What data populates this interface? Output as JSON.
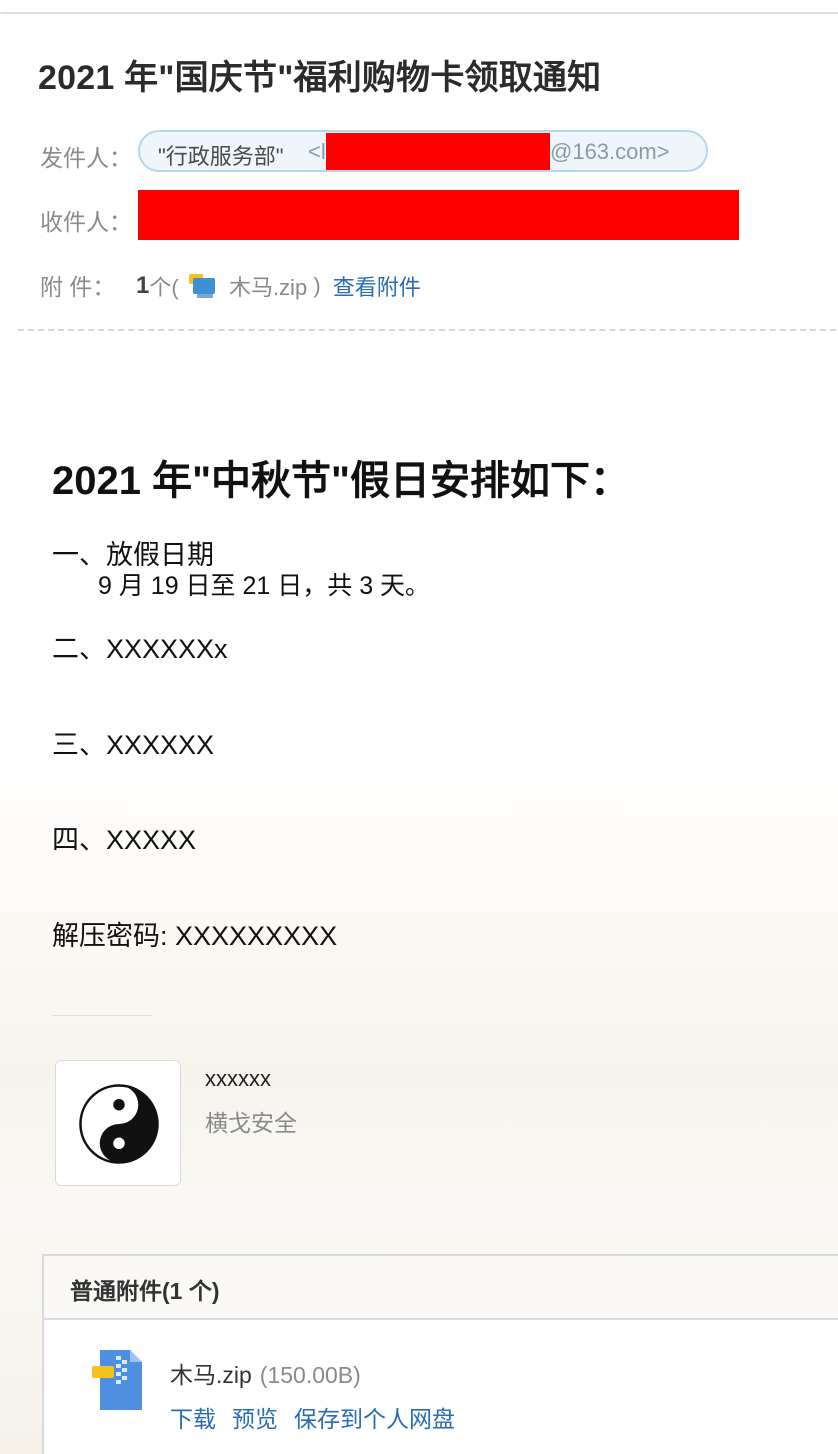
{
  "email": {
    "subject": "2021 年\"国庆节\"福利购物卡领取通知",
    "labels": {
      "from": "发件人：",
      "to": "收件人：",
      "attachments": "附    件："
    },
    "sender": {
      "name": "\"行政服务部\"",
      "open_bracket": "<l",
      "domain_tail": "@163.com>"
    },
    "attachments_summary": {
      "count": "1",
      "count_suffix": "个(",
      "file_name": "木马.zip",
      "close": ")",
      "view_link": "查看附件"
    }
  },
  "body": {
    "title": "2021 年\"中秋节\"假日安排如下：",
    "section_1": "一、放假日期",
    "section_1_detail": "9 月 19 日至 21 日，共 3 天。",
    "section_2": "二、XXXXXXx",
    "section_3": "三、XXXXXX",
    "section_4": "四、XXXXX",
    "password": "解压密码: XXXXXXXXX"
  },
  "signature": {
    "name": "xxxxxx",
    "company": "横戈安全",
    "logo_icon": "yin-yang-icon"
  },
  "attachment_panel": {
    "title": "普通附件(1 个)",
    "file": {
      "name": "木马.zip",
      "size": "(150.00B)",
      "icon": "zip-file-icon"
    },
    "actions": {
      "download": "下载",
      "preview": "预览",
      "save": "保存到个人网盘"
    }
  },
  "colors": {
    "link": "#2a6db0",
    "redaction": "#ff0000",
    "sender_chip_bg": "#eef6fc",
    "sender_chip_border": "#b8d6ea"
  }
}
